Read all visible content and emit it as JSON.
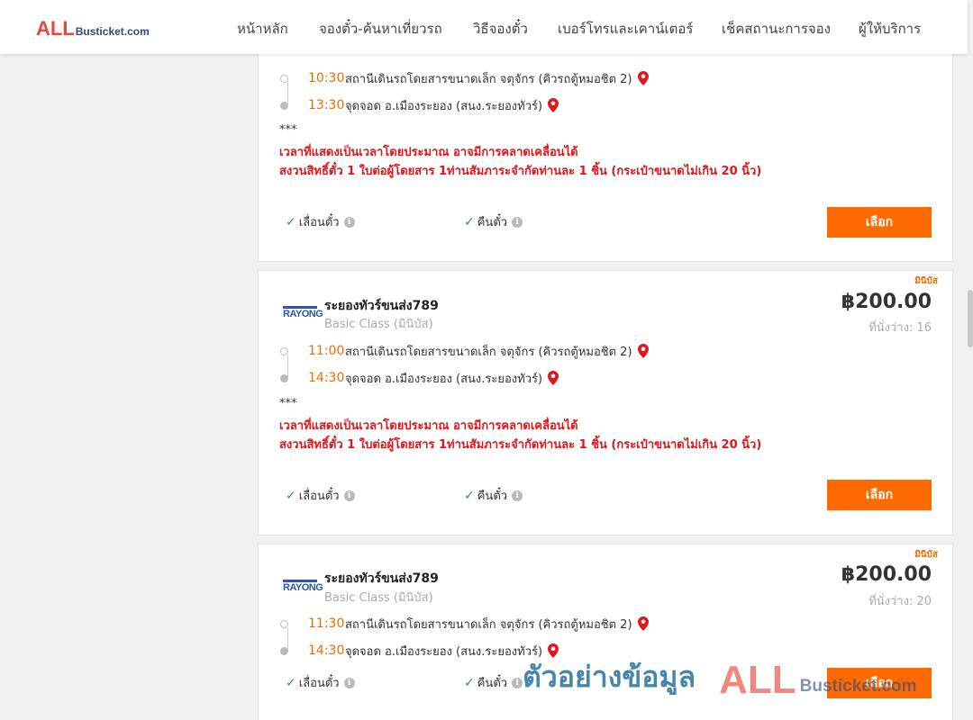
{
  "header": {
    "logo_all": "ALL",
    "logo_rest": "Busticket.com",
    "nav": [
      "หน้าหลัก",
      "จองตั๋ว-ค้นหาเที่ยวรถ",
      "วิธีจองตั๋ว",
      "เบอร์โทรและเคาน์เตอร์",
      "เช็คสถานะการจอง",
      "ผู้ให้บริการ"
    ]
  },
  "card0": {
    "departure_time": "10:30",
    "departure_place": "สถานีเดินรถโดยสารขนาดเล็ก จตุจักร (คิวรถตู้หมอชิต 2)",
    "arrival_time": "13:30",
    "arrival_place": "จุดจอด อ.เมืองระยอง (สนง.ระยองทัวร์)",
    "stars": "***",
    "notice1": "เวลาที่แสดงเป็นเวลาโดยประมาณ อาจมีการคลาดเคลื่อนได้",
    "notice2": "สงวนสิทธิ์ตั๋ว 1 ใบต่อผู้โดยสาร 1ท่านสัมภาระจำกัดท่านละ 1 ชิ้น (กระเป๋าขนาดไม่เกิน 20 นิ้ว)",
    "feature_change": "เลื่อนตั๋ว",
    "feature_refund": "คืนตั๋ว",
    "select_label": "เลือก"
  },
  "card1": {
    "tag": "มินิบัส",
    "operator_logo": "RAYONG",
    "operator_name": "ระยองทัวร์ขนส่ง789",
    "bus_class": "Basic Class (มินิบัส)",
    "price": "฿200.00",
    "seats": "ที่นั่งว่าง: 16",
    "departure_time": "11:00",
    "departure_place": "สถานีเดินรถโดยสารขนาดเล็ก จตุจักร (คิวรถตู้หมอชิต 2)",
    "arrival_time": "14:30",
    "arrival_place": "จุดจอด อ.เมืองระยอง (สนง.ระยองทัวร์)",
    "stars": "***",
    "notice1": "เวลาที่แสดงเป็นเวลาโดยประมาณ อาจมีการคลาดเคลื่อนได้",
    "notice2": "สงวนสิทธิ์ตั๋ว 1 ใบต่อผู้โดยสาร 1ท่านสัมภาระจำกัดท่านละ 1 ชิ้น (กระเป๋าขนาดไม่เกิน 20 นิ้ว)",
    "feature_change": "เลื่อนตั๋ว",
    "feature_refund": "คืนตั๋ว",
    "select_label": "เลือก"
  },
  "card2": {
    "tag": "มินิบัส",
    "operator_logo": "RAYONG",
    "operator_name": "ระยองทัวร์ขนส่ง789",
    "bus_class": "Basic Class (มินิบัส)",
    "price": "฿200.00",
    "seats": "ที่นั่งว่าง: 20",
    "departure_time": "11:30",
    "departure_place": "สถานีเดินรถโดยสารขนาดเล็ก จตุจักร (คิวรถตู้หมอชิต 2)",
    "arrival_time": "14:30",
    "arrival_place": "จุดจอด อ.เมืองระยอง (สนง.ระยองทัวร์)",
    "feature_change": "เลื่อนตั๋ว",
    "feature_refund": "คืนตั๋ว",
    "select_label": "เลือก"
  },
  "watermark": {
    "thai": "ตัวอย่างข้อมูล",
    "all": "ALL",
    "rest": "Busticket.com"
  },
  "colors": {
    "accent": "#ff6a00",
    "time": "#f06c00",
    "notice": "#e2151b",
    "check": "#2e9e3a"
  }
}
